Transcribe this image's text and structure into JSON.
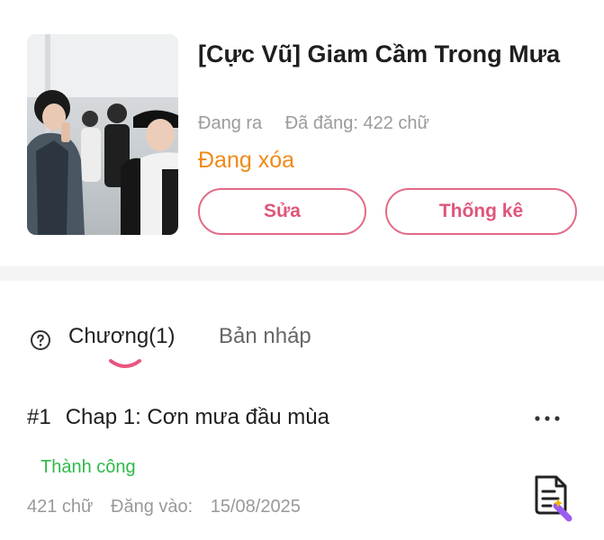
{
  "story": {
    "title": "[Cực Vũ] Giam Cầm Trong Mưa",
    "status": "Đang ra",
    "posted_words": "Đã đăng: 422 chữ",
    "deleting_label": "Đang xóa",
    "cover_icon": "cover-image"
  },
  "actions": {
    "edit_label": "Sửa",
    "stats_label": "Thống kê"
  },
  "tabs": {
    "help_icon": "question-circle-icon",
    "chapters_label": "Chương(1)",
    "drafts_label": "Bản nháp",
    "active": "chapters"
  },
  "chapters": [
    {
      "number": "#1",
      "title": "Chap 1: Cơn mưa đầu mùa",
      "status": "Thành công",
      "words": "421 chữ",
      "date_label": "Đăng vào:",
      "date": "15/08/2025"
    }
  ],
  "colors": {
    "accent": "#e16a86",
    "deleting": "#ef8a17",
    "success": "#2fb84a",
    "muted": "#9b9b9b"
  }
}
